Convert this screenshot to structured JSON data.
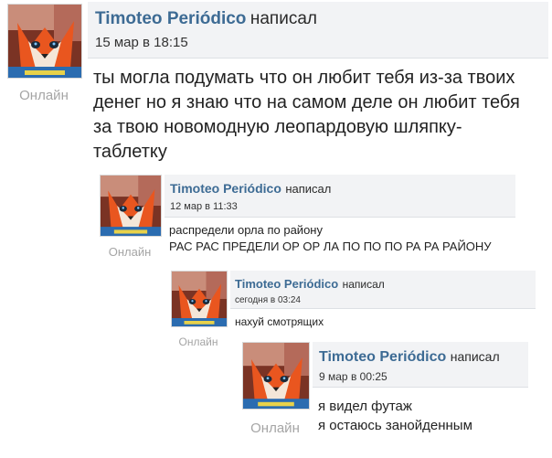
{
  "main": {
    "author": "Timoteo Periódico",
    "wrote": "написал",
    "date": "15 мар в 18:15",
    "status": "Онлайн",
    "lines": [
      "ты могла подумать что он любит тебя из-за твоих",
      "денег но я знаю что на самом деле он любит тебя",
      "за твою новомодную леопардовую шляпку-",
      "таблетку"
    ]
  },
  "quote1": {
    "author": "Timoteo Periódico",
    "wrote": "написал",
    "date": "12 мар в 11:33",
    "status": "Онлайн",
    "lines": [
      "распредели орла по району",
      "РАС РАС ПРЕДЕЛИ ОР ОР ЛА ПО ПО ПО РА РА РАЙОНУ"
    ]
  },
  "quote2": {
    "author": "Timoteo Periódico",
    "wrote": "написал",
    "date": "сегодня в 03:24",
    "status": "Онлайн",
    "lines": [
      "нахуй смотрящих"
    ]
  },
  "quote3": {
    "author": "Timoteo Periódico",
    "wrote": "написал",
    "date": "9 мар в 00:25",
    "status": "Онлайн",
    "lines": [
      "я видел футаж",
      "я остаюсь занойденным"
    ]
  },
  "avatar_icon": "fox-avatar-icon",
  "colors": {
    "author": "#3d6b94",
    "header_bg": "#f2f3f5",
    "status": "#a5a5a5"
  }
}
